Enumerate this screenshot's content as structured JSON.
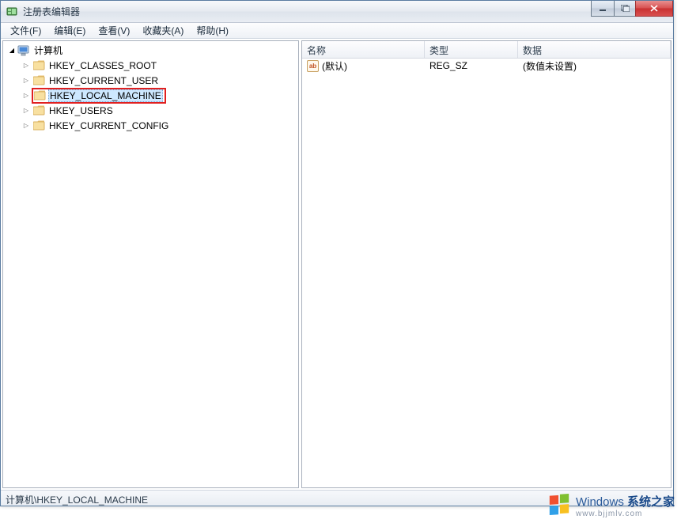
{
  "window": {
    "title": "注册表编辑器"
  },
  "menu": {
    "file": "文件(F)",
    "edit": "编辑(E)",
    "view": "查看(V)",
    "favorites": "收藏夹(A)",
    "help": "帮助(H)"
  },
  "tree": {
    "root": "计算机",
    "items": [
      "HKEY_CLASSES_ROOT",
      "HKEY_CURRENT_USER",
      "HKEY_LOCAL_MACHINE",
      "HKEY_USERS",
      "HKEY_CURRENT_CONFIG"
    ]
  },
  "list": {
    "headers": {
      "name": "名称",
      "type": "类型",
      "data": "数据"
    },
    "rows": [
      {
        "name": "(默认)",
        "type": "REG_SZ",
        "data": "(数值未设置)"
      }
    ]
  },
  "statusbar": "计算机\\HKEY_LOCAL_MACHINE",
  "watermark": {
    "brand_prefix": "Windows",
    "brand_suffix": " 系统之家",
    "url": "www.bjjmlv.com"
  }
}
